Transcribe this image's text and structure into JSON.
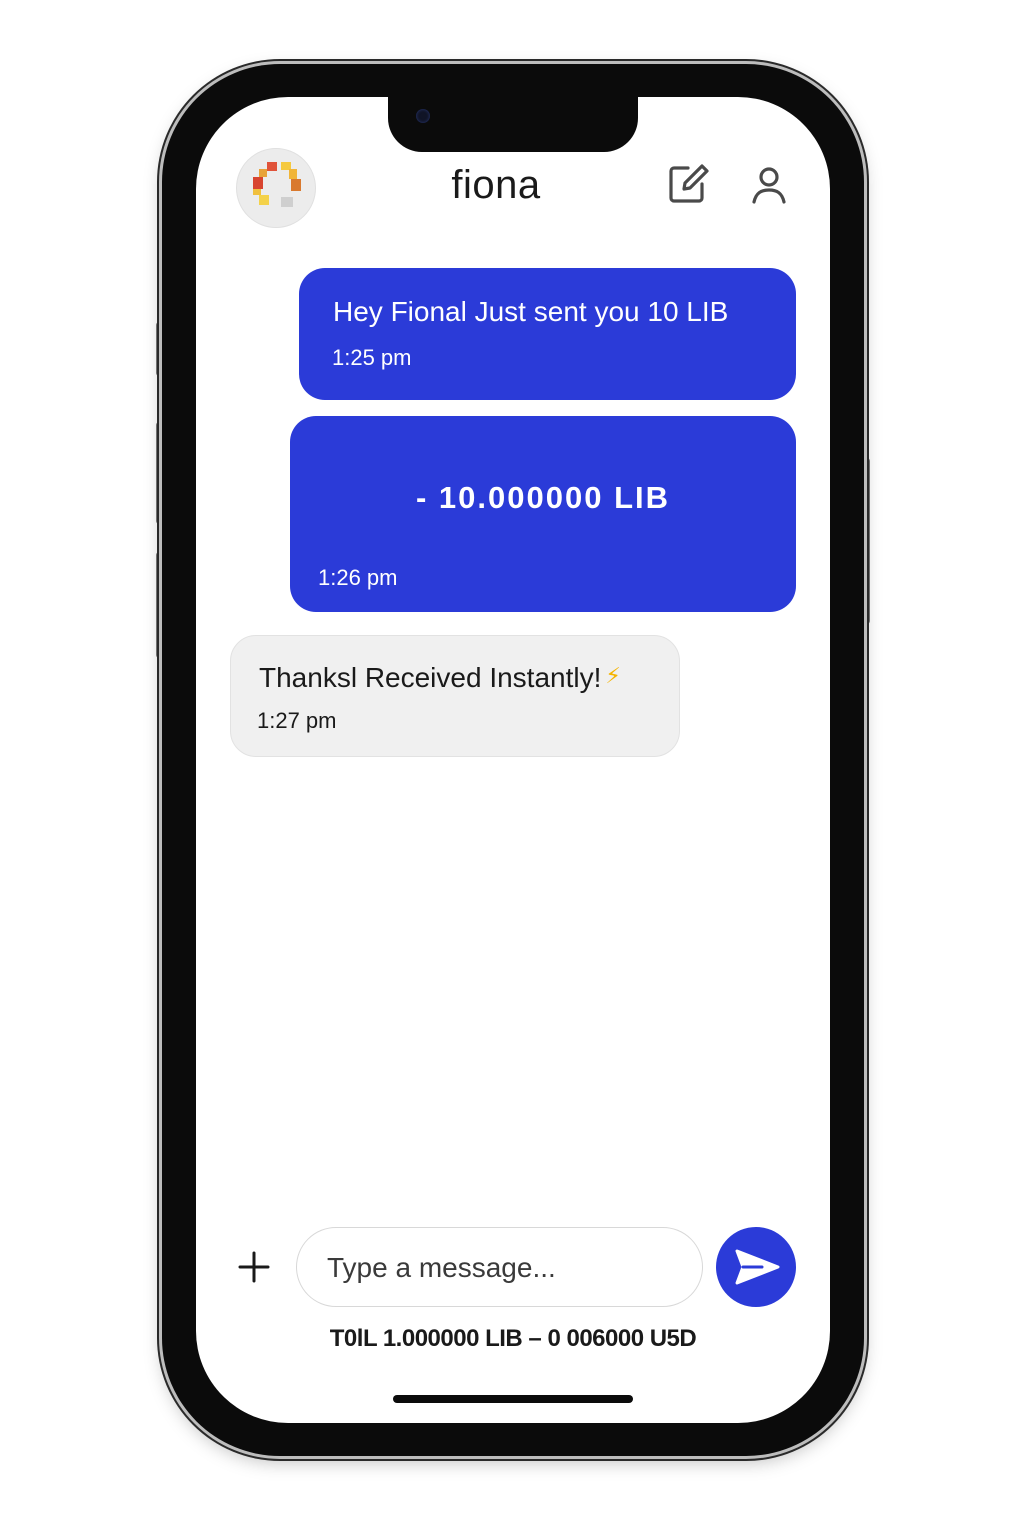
{
  "header": {
    "title": "fiona",
    "avatar_icon": "pixel-logo-icon",
    "compose_icon": "compose-icon",
    "profile_icon": "person-icon"
  },
  "messages": [
    {
      "direction": "sent",
      "text": "Hey Fional Just sent you 10 LIB",
      "time": "1:25 pm"
    },
    {
      "direction": "sent",
      "amount": "-  10.000000 LIB",
      "time": "1:26 pm"
    },
    {
      "direction": "received",
      "text": "Thanksl Received Instantly!",
      "emoji": "⚡",
      "time": "1:27 pm"
    }
  ],
  "composer": {
    "add_icon": "plus-icon",
    "placeholder": "Type a message...",
    "value": "",
    "send_icon": "send-icon"
  },
  "summary": "T0lL 1.000000 LIB – 0 006000 U5D",
  "colors": {
    "accent": "#2b3bd8",
    "received_bubble": "#f0f0f0",
    "emoji": "#f5b400"
  }
}
